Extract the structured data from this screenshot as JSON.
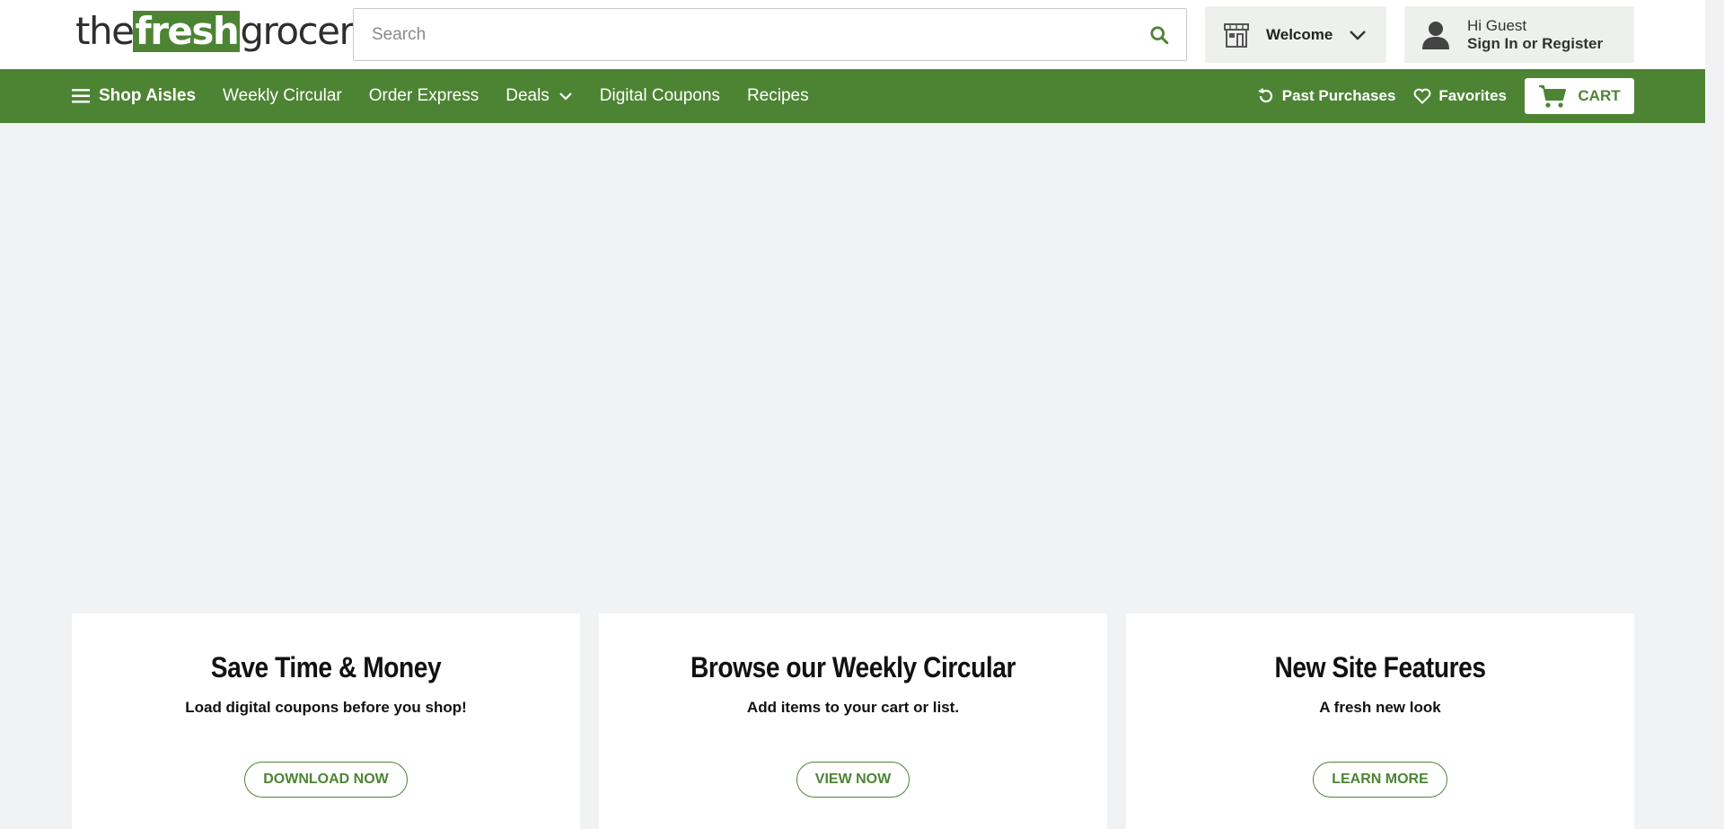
{
  "header": {
    "logo": {
      "the": "the",
      "fresh": "fresh",
      "grocer": "grocer",
      "reg": "®"
    },
    "search": {
      "placeholder": "Search",
      "value": ""
    },
    "store": {
      "label": "Welcome"
    },
    "account": {
      "greeting": "Hi Guest",
      "action": "Sign In or Register"
    }
  },
  "nav": {
    "items": [
      {
        "label": "Shop Aisles"
      },
      {
        "label": "Weekly Circular"
      },
      {
        "label": "Order Express"
      },
      {
        "label": "Deals"
      },
      {
        "label": "Digital Coupons"
      },
      {
        "label": "Recipes"
      }
    ],
    "past_purchases": "Past Purchases",
    "favorites": "Favorites",
    "cart": "CART"
  },
  "cards": [
    {
      "title": "Save Time & Money",
      "subtitle": "Load digital coupons before you shop!",
      "button": "DOWNLOAD NOW"
    },
    {
      "title": "Browse our Weekly Circular",
      "subtitle": "Add items to your cart or list.",
      "button": "VIEW NOW"
    },
    {
      "title": "New Site Features",
      "subtitle": "A fresh new look",
      "button": "LEARN MORE"
    }
  ],
  "colors": {
    "brand_green": "#4d8434",
    "page_bg": "#f1f2f4"
  }
}
